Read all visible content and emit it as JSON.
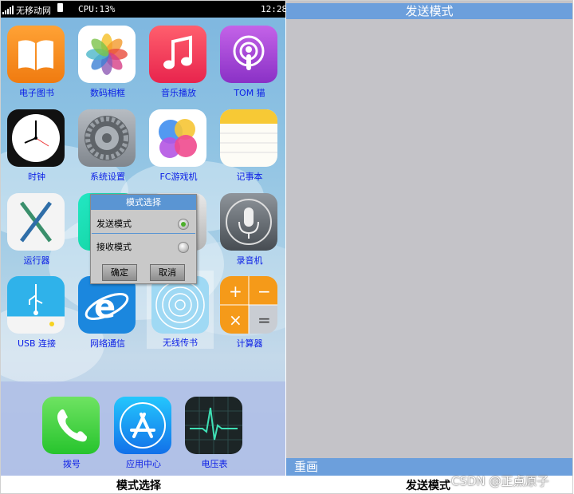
{
  "status_bar": {
    "carrier": "无移动网",
    "cpu": "CPU:13%",
    "time": "12:28"
  },
  "apps": [
    {
      "label": "电子图书",
      "icon": "book-icon"
    },
    {
      "label": "数码相框",
      "icon": "photos-icon"
    },
    {
      "label": "音乐播放",
      "icon": "music-icon"
    },
    {
      "label": "TOM 猫",
      "icon": "podcast-icon"
    },
    {
      "label": "时钟",
      "icon": "clock-icon"
    },
    {
      "label": "系统设置",
      "icon": "settings-gear-icon"
    },
    {
      "label": "FC游戏机",
      "icon": "game-center-icon"
    },
    {
      "label": "记事本",
      "icon": "notes-icon"
    },
    {
      "label": "运行器",
      "icon": "osx-x-icon"
    },
    {
      "label": "",
      "icon": "hidden-app-icon"
    },
    {
      "label": "",
      "icon": "hidden-app-icon"
    },
    {
      "label": "录音机",
      "icon": "microphone-icon"
    },
    {
      "label": "USB 连接",
      "icon": "usb-icon"
    },
    {
      "label": "网络通信",
      "icon": "internet-explorer-icon"
    },
    {
      "label": "无线传书",
      "icon": "wireless-icon"
    },
    {
      "label": "计算器",
      "icon": "calculator-icon"
    }
  ],
  "dock": [
    {
      "label": "拨号",
      "icon": "phone-icon"
    },
    {
      "label": "应用中心",
      "icon": "app-store-icon"
    },
    {
      "label": "电压表",
      "icon": "voltmeter-icon"
    }
  ],
  "dialog": {
    "title": "模式选择",
    "options": [
      {
        "label": "发送模式",
        "selected": true
      },
      {
        "label": "接收模式",
        "selected": false
      }
    ],
    "ok_label": "确定",
    "cancel_label": "取消"
  },
  "right_panel": {
    "title": "发送模式",
    "redraw_label": "重画"
  },
  "captions": {
    "left": "模式选择",
    "right": "发送模式"
  },
  "watermark": "CSDN @正点原子",
  "colors": {
    "label_blue": "#0b1ee6",
    "title_bar": "#6c9fdc",
    "dialog_title": "#5a95d3",
    "panel_bg": "#c4c3c8"
  }
}
